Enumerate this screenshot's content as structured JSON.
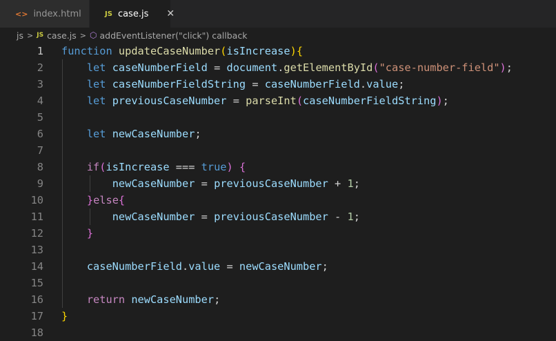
{
  "tabs": [
    {
      "label": "index.html",
      "icon": "html-file-icon",
      "active": false
    },
    {
      "label": "case.js",
      "icon": "js-file-icon",
      "active": true,
      "close": "✕"
    }
  ],
  "breadcrumb": {
    "folder": "js",
    "file": "case.js",
    "symbol": "addEventListener(\"click\") callback"
  },
  "colors": {
    "keyword": "#569cd6",
    "control": "#c586c0",
    "function": "#dcdcaa",
    "variable": "#9cdcfe",
    "string": "#ce9178",
    "number": "#b5cea8"
  },
  "editor": {
    "current_line": 1,
    "lines": [
      {
        "n": "1",
        "tokens": [
          {
            "t": "function",
            "c": "k-blue"
          },
          {
            "t": " ",
            "c": "plain"
          },
          {
            "t": "updateCaseNumber",
            "c": "fn"
          },
          {
            "t": "(",
            "c": "br1"
          },
          {
            "t": "isIncrease",
            "c": "var"
          },
          {
            "t": ")",
            "c": "br1"
          },
          {
            "t": "{",
            "c": "br1"
          }
        ]
      },
      {
        "n": "2",
        "tokens": [
          {
            "t": "    ",
            "c": "plain"
          },
          {
            "t": "let",
            "c": "k-blue"
          },
          {
            "t": " ",
            "c": "plain"
          },
          {
            "t": "caseNumberField",
            "c": "var"
          },
          {
            "t": " = ",
            "c": "plain"
          },
          {
            "t": "document",
            "c": "var"
          },
          {
            "t": ".",
            "c": "plain"
          },
          {
            "t": "getElementById",
            "c": "fn"
          },
          {
            "t": "(",
            "c": "br2"
          },
          {
            "t": "\"case-number-field\"",
            "c": "str"
          },
          {
            "t": ")",
            "c": "br2"
          },
          {
            "t": ";",
            "c": "plain"
          }
        ]
      },
      {
        "n": "3",
        "tokens": [
          {
            "t": "    ",
            "c": "plain"
          },
          {
            "t": "let",
            "c": "k-blue"
          },
          {
            "t": " ",
            "c": "plain"
          },
          {
            "t": "caseNumberFieldString",
            "c": "var"
          },
          {
            "t": " = ",
            "c": "plain"
          },
          {
            "t": "caseNumberField",
            "c": "var"
          },
          {
            "t": ".",
            "c": "plain"
          },
          {
            "t": "value",
            "c": "var"
          },
          {
            "t": ";",
            "c": "plain"
          }
        ]
      },
      {
        "n": "4",
        "tokens": [
          {
            "t": "    ",
            "c": "plain"
          },
          {
            "t": "let",
            "c": "k-blue"
          },
          {
            "t": " ",
            "c": "plain"
          },
          {
            "t": "previousCaseNumber",
            "c": "var"
          },
          {
            "t": " = ",
            "c": "plain"
          },
          {
            "t": "parseInt",
            "c": "fn"
          },
          {
            "t": "(",
            "c": "br2"
          },
          {
            "t": "caseNumberFieldString",
            "c": "var"
          },
          {
            "t": ")",
            "c": "br2"
          },
          {
            "t": ";",
            "c": "plain"
          }
        ]
      },
      {
        "n": "5",
        "tokens": []
      },
      {
        "n": "6",
        "tokens": [
          {
            "t": "    ",
            "c": "plain"
          },
          {
            "t": "let",
            "c": "k-blue"
          },
          {
            "t": " ",
            "c": "plain"
          },
          {
            "t": "newCaseNumber",
            "c": "var"
          },
          {
            "t": ";",
            "c": "plain"
          }
        ]
      },
      {
        "n": "7",
        "tokens": []
      },
      {
        "n": "8",
        "tokens": [
          {
            "t": "    ",
            "c": "plain"
          },
          {
            "t": "if",
            "c": "k-purple"
          },
          {
            "t": "(",
            "c": "br2"
          },
          {
            "t": "isIncrease",
            "c": "var"
          },
          {
            "t": " === ",
            "c": "plain"
          },
          {
            "t": "true",
            "c": "k-blue"
          },
          {
            "t": ")",
            "c": "br2"
          },
          {
            "t": " ",
            "c": "plain"
          },
          {
            "t": "{",
            "c": "br2"
          }
        ]
      },
      {
        "n": "9",
        "tokens": [
          {
            "t": "        ",
            "c": "plain"
          },
          {
            "t": "newCaseNumber",
            "c": "var"
          },
          {
            "t": " = ",
            "c": "plain"
          },
          {
            "t": "previousCaseNumber",
            "c": "var"
          },
          {
            "t": " + ",
            "c": "plain"
          },
          {
            "t": "1",
            "c": "num"
          },
          {
            "t": ";",
            "c": "plain"
          }
        ]
      },
      {
        "n": "10",
        "tokens": [
          {
            "t": "    ",
            "c": "plain"
          },
          {
            "t": "}",
            "c": "br2"
          },
          {
            "t": "else",
            "c": "k-purple"
          },
          {
            "t": "{",
            "c": "br2"
          }
        ]
      },
      {
        "n": "11",
        "tokens": [
          {
            "t": "        ",
            "c": "plain"
          },
          {
            "t": "newCaseNumber",
            "c": "var"
          },
          {
            "t": " = ",
            "c": "plain"
          },
          {
            "t": "previousCaseNumber",
            "c": "var"
          },
          {
            "t": " - ",
            "c": "plain"
          },
          {
            "t": "1",
            "c": "num"
          },
          {
            "t": ";",
            "c": "plain"
          }
        ]
      },
      {
        "n": "12",
        "tokens": [
          {
            "t": "    ",
            "c": "plain"
          },
          {
            "t": "}",
            "c": "br2"
          }
        ]
      },
      {
        "n": "13",
        "tokens": []
      },
      {
        "n": "14",
        "tokens": [
          {
            "t": "    ",
            "c": "plain"
          },
          {
            "t": "caseNumberField",
            "c": "var"
          },
          {
            "t": ".",
            "c": "plain"
          },
          {
            "t": "value",
            "c": "var"
          },
          {
            "t": " = ",
            "c": "plain"
          },
          {
            "t": "newCaseNumber",
            "c": "var"
          },
          {
            "t": ";",
            "c": "plain"
          }
        ]
      },
      {
        "n": "15",
        "tokens": []
      },
      {
        "n": "16",
        "tokens": [
          {
            "t": "    ",
            "c": "plain"
          },
          {
            "t": "return",
            "c": "k-purple"
          },
          {
            "t": " ",
            "c": "plain"
          },
          {
            "t": "newCaseNumber",
            "c": "var"
          },
          {
            "t": ";",
            "c": "plain"
          }
        ]
      },
      {
        "n": "17",
        "tokens": [
          {
            "t": "}",
            "c": "br1"
          }
        ]
      },
      {
        "n": "18",
        "tokens": []
      }
    ]
  }
}
